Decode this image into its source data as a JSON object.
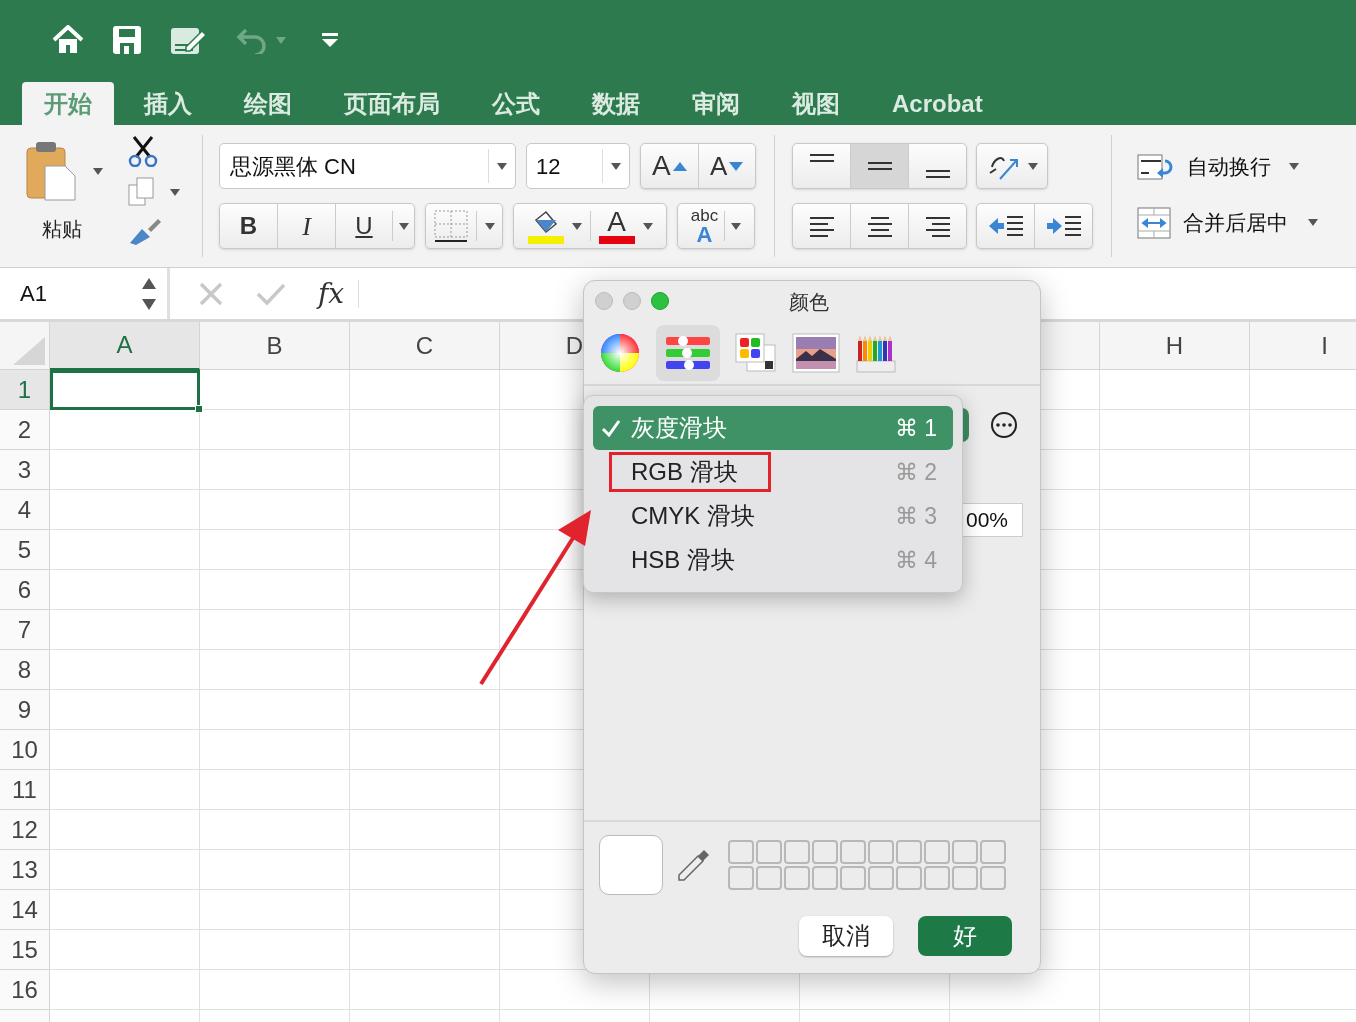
{
  "ribbon_tabs": [
    {
      "label": "开始",
      "selected": true
    },
    {
      "label": "插入",
      "selected": false
    },
    {
      "label": "绘图",
      "selected": false
    },
    {
      "label": "页面布局",
      "selected": false
    },
    {
      "label": "公式",
      "selected": false
    },
    {
      "label": "数据",
      "selected": false
    },
    {
      "label": "审阅",
      "selected": false
    },
    {
      "label": "视图",
      "selected": false
    },
    {
      "label": "Acrobat",
      "selected": false
    }
  ],
  "clipboard": {
    "paste_label": "粘贴"
  },
  "font": {
    "name": "思源黑体 CN",
    "size": "12",
    "grow_label": "A",
    "shrink_label": "A",
    "bold_label": "B",
    "italic_label": "I",
    "underline_label": "U",
    "color_label": "A",
    "effects_top": "abc",
    "effects_bottom": "A"
  },
  "vertical_align": [
    {
      "kind": "top",
      "selected": false
    },
    {
      "kind": "middle",
      "selected": true
    },
    {
      "kind": "bottom",
      "selected": false
    }
  ],
  "wrap_text": "自动换行",
  "merge_center": "合并后居中",
  "name_box": "A1",
  "formula_label": "fx",
  "columns": [
    {
      "label": "A",
      "selected": true
    },
    {
      "label": "B",
      "selected": false
    },
    {
      "label": "C",
      "selected": false
    },
    {
      "label": "D",
      "selected": false
    },
    {
      "label": "H",
      "selected": false
    },
    {
      "label": "I",
      "selected": false
    }
  ],
  "rows": [
    {
      "label": "1",
      "selected": true
    },
    {
      "label": "2",
      "selected": false
    },
    {
      "label": "3",
      "selected": false
    },
    {
      "label": "4",
      "selected": false
    },
    {
      "label": "5",
      "selected": false
    },
    {
      "label": "6",
      "selected": false
    },
    {
      "label": "7",
      "selected": false
    },
    {
      "label": "8",
      "selected": false
    },
    {
      "label": "9",
      "selected": false
    },
    {
      "label": "10",
      "selected": false
    },
    {
      "label": "11",
      "selected": false
    },
    {
      "label": "12",
      "selected": false
    },
    {
      "label": "13",
      "selected": false
    },
    {
      "label": "14",
      "selected": false
    },
    {
      "label": "15",
      "selected": false
    },
    {
      "label": "16",
      "selected": false
    }
  ],
  "color_panel": {
    "title": "颜色",
    "modes": [
      {
        "kind": "wheel",
        "selected": false
      },
      {
        "kind": "sliders",
        "selected": true
      },
      {
        "kind": "palettes",
        "selected": false
      },
      {
        "kind": "image",
        "selected": false
      },
      {
        "kind": "pencils",
        "selected": false
      }
    ],
    "opacity_value": "00%",
    "buttons": [
      {
        "label": "取消",
        "kind": "cancel"
      },
      {
        "label": "好",
        "kind": "default"
      }
    ]
  },
  "slider_menu": [
    {
      "label": "灰度滑块",
      "shortcut": "⌘ 1",
      "checked": true,
      "selected": true,
      "annotated": false
    },
    {
      "label": "RGB 滑块",
      "shortcut": "⌘ 2",
      "checked": false,
      "selected": false,
      "annotated": true
    },
    {
      "label": "CMYK 滑块",
      "shortcut": "⌘ 3",
      "checked": false,
      "selected": false,
      "annotated": false
    },
    {
      "label": "HSB 滑块",
      "shortcut": "⌘ 4",
      "checked": false,
      "selected": false,
      "annotated": false
    }
  ]
}
